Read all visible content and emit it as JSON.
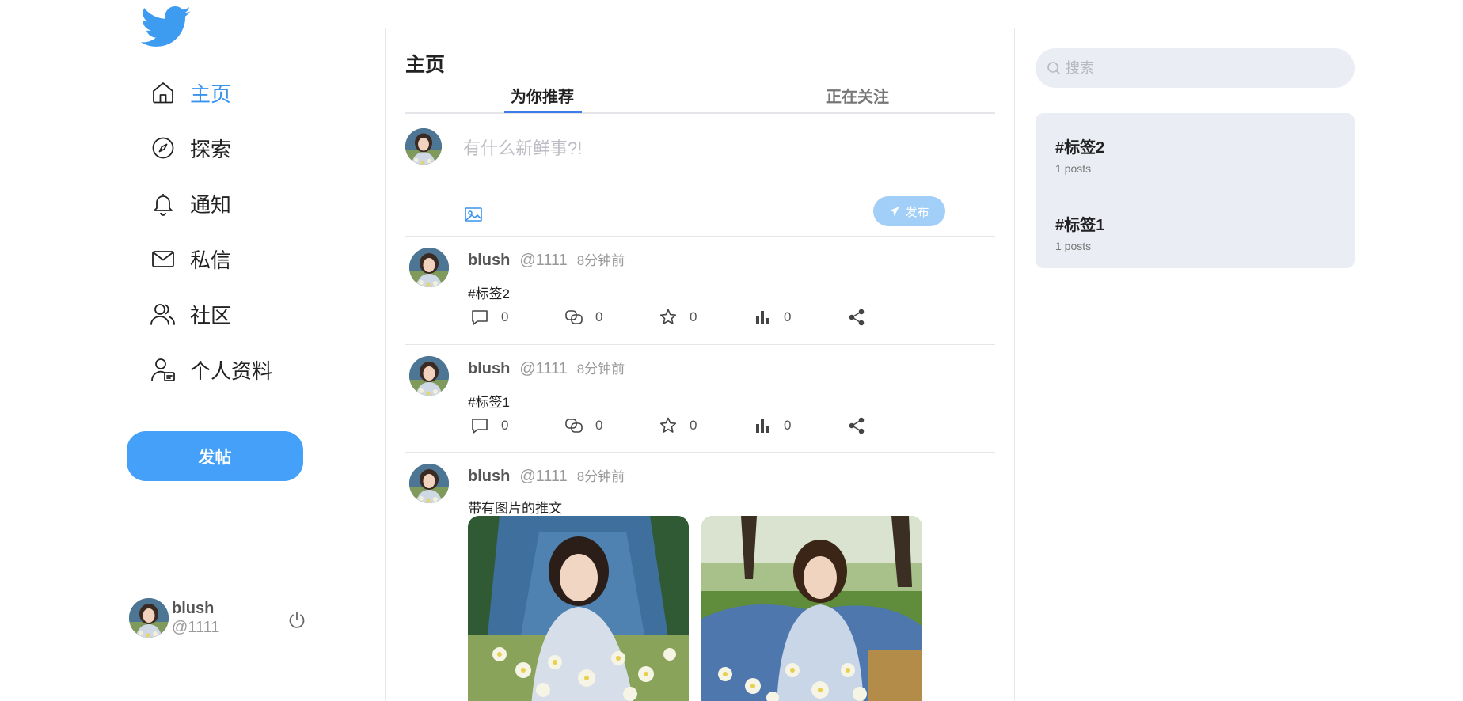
{
  "nav": {
    "items": [
      {
        "label": "主页",
        "icon": "home-icon"
      },
      {
        "label": "探索",
        "icon": "compass-icon"
      },
      {
        "label": "通知",
        "icon": "bell-icon"
      },
      {
        "label": "私信",
        "icon": "mail-icon"
      },
      {
        "label": "社区",
        "icon": "users-icon"
      },
      {
        "label": "个人资料",
        "icon": "profile-icon"
      }
    ],
    "post_button": "发帖"
  },
  "current_user": {
    "name": "blush",
    "handle": "@1111"
  },
  "main": {
    "title": "主页",
    "tabs": [
      {
        "label": "为你推荐"
      },
      {
        "label": "正在关注"
      }
    ],
    "composer": {
      "placeholder": "有什么新鲜事?!",
      "publish_label": "发布"
    },
    "posts": [
      {
        "name": "blush",
        "handle": "@1111",
        "time": "8分钟前",
        "text": "#标签2",
        "stats": {
          "comments": "0",
          "reposts": "0",
          "likes": "0",
          "views": "0"
        }
      },
      {
        "name": "blush",
        "handle": "@1111",
        "time": "8分钟前",
        "text": "#标签1",
        "stats": {
          "comments": "0",
          "reposts": "0",
          "likes": "0",
          "views": "0"
        }
      },
      {
        "name": "blush",
        "handle": "@1111",
        "time": "8分钟前",
        "text": "带有图片的推文"
      }
    ]
  },
  "right": {
    "search_placeholder": "搜索",
    "trends": [
      {
        "tag": "#标签2",
        "count": "1 posts"
      },
      {
        "tag": "#标签1",
        "count": "1 posts"
      }
    ]
  },
  "colors": {
    "accent": "#3a94ec",
    "button": "#44a0f9",
    "publish_disabled": "#a2cff7",
    "panel": "#ebedf4"
  }
}
